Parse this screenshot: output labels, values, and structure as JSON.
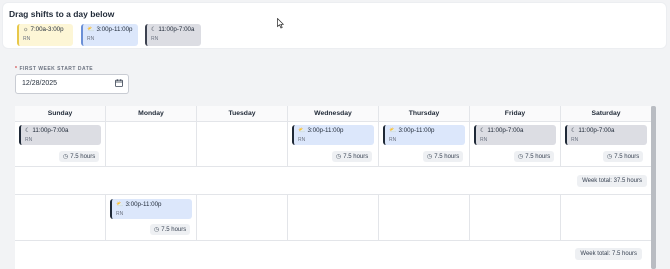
{
  "palette": {
    "title": "Drag shifts to a day below",
    "shifts": [
      {
        "icon": "sun-icon",
        "time": "7:00a-3:00p",
        "role": "RN",
        "color": "yellow"
      },
      {
        "icon": "sunset-icon",
        "time": "3:00p-11:00p",
        "role": "RN",
        "color": "blue"
      },
      {
        "icon": "moon-icon",
        "time": "11:00p-7:00a",
        "role": "RN",
        "color": "gray"
      }
    ]
  },
  "date_picker": {
    "required_marker": "*",
    "label": "FIRST WEEK START DATE",
    "value": "12/28/2025"
  },
  "calendar": {
    "days": [
      "Sunday",
      "Monday",
      "Tuesday",
      "Wednesday",
      "Thursday",
      "Friday",
      "Saturday"
    ],
    "week1": {
      "sunday": {
        "time": "11:00p-7:00a",
        "role": "RN",
        "hours": "7.5 hours"
      },
      "wednesday": {
        "time": "3:00p-11:00p",
        "role": "RN",
        "hours": "7.5 hours"
      },
      "thursday": {
        "time": "3:00p-11:00p",
        "role": "RN",
        "hours": "7.5 hours"
      },
      "friday": {
        "time": "11:00p-7:00a",
        "role": "RN",
        "hours": "7.5 hours"
      },
      "saturday": {
        "time": "11:00p-7:00a",
        "role": "RN",
        "hours": "7.5 hours"
      },
      "total": "Week total: 37.5 hours"
    },
    "week2": {
      "monday": {
        "time": "3:00p-11:00p",
        "role": "RN",
        "hours": "7.5 hours"
      },
      "total": "Week total: 7.5 hours"
    }
  },
  "colors": {
    "yellow_bg": "#fdf6d6",
    "blue_bg": "#dce7fb",
    "gray_bg": "#dcdde3"
  }
}
